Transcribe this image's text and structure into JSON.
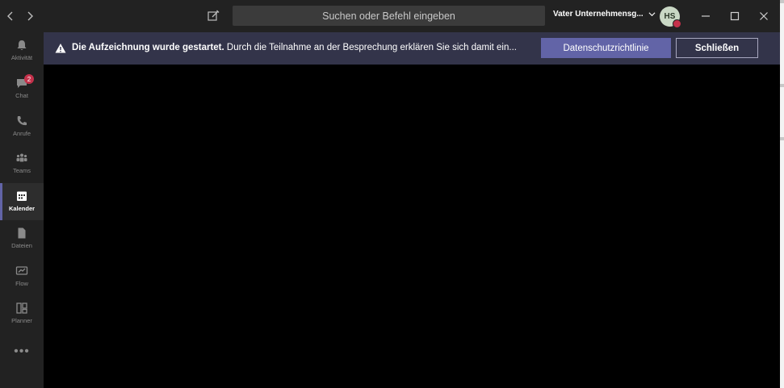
{
  "titlebar": {
    "search_placeholder": "Suchen oder Befehl eingeben",
    "tenant_name": "Vater Unternehmensg...",
    "avatar_initials": "HS",
    "presence_color": "#c4314b"
  },
  "rail": {
    "items": [
      {
        "label": "Aktivität",
        "icon": "bell-icon"
      },
      {
        "label": "Chat",
        "icon": "chat-icon",
        "badge": "2"
      },
      {
        "label": "Anrufe",
        "icon": "phone-icon"
      },
      {
        "label": "Teams",
        "icon": "teams-icon"
      },
      {
        "label": "Kalender",
        "icon": "calendar-icon",
        "active": true
      },
      {
        "label": "Dateien",
        "icon": "file-icon"
      },
      {
        "label": "Flow",
        "icon": "flow-icon"
      },
      {
        "label": "Planner",
        "icon": "planner-icon"
      }
    ],
    "more_label": "•••"
  },
  "banner": {
    "title": "Die Aufzeichnung wurde gestartet.",
    "message": "Durch die Teilnahme an der Besprechung erklären Sie sich damit ein...",
    "privacy_button": "Datenschutzrichtlinie",
    "close_button": "Schließen"
  },
  "colors": {
    "accent": "#6264a7",
    "banner_bg": "#33344a",
    "chrome_bg": "#222222",
    "badge": "#c4314b"
  }
}
